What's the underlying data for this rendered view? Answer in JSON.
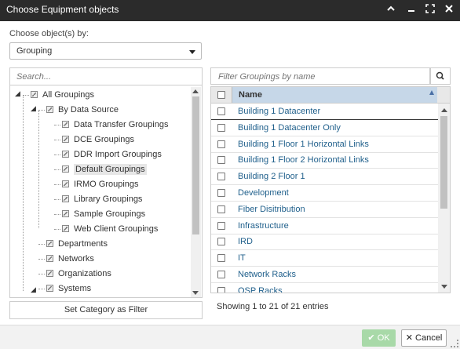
{
  "window": {
    "title": "Choose Equipment objects",
    "controls": [
      "collapse-icon",
      "minimize-icon",
      "maximize-icon",
      "close-icon"
    ]
  },
  "chooser": {
    "label": "Choose object(s) by:",
    "selected": "Grouping"
  },
  "left": {
    "search_placeholder": "Search...",
    "tree": [
      {
        "label": "All Groupings",
        "depth": 0,
        "expanded": true
      },
      {
        "label": "By Data Source",
        "depth": 1,
        "expanded": true
      },
      {
        "label": "Data Transfer Groupings",
        "depth": 2
      },
      {
        "label": "DCE Groupings",
        "depth": 2
      },
      {
        "label": "DDR Import Groupings",
        "depth": 2
      },
      {
        "label": "Default Groupings",
        "depth": 2,
        "selected": true
      },
      {
        "label": "IRMO Groupings",
        "depth": 2
      },
      {
        "label": "Library Groupings",
        "depth": 2
      },
      {
        "label": "Sample Groupings",
        "depth": 2
      },
      {
        "label": "Web Client Groupings",
        "depth": 2
      },
      {
        "label": "Departments",
        "depth": 1
      },
      {
        "label": "Networks",
        "depth": 1
      },
      {
        "label": "Organizations",
        "depth": 1
      },
      {
        "label": "Systems",
        "depth": 1,
        "expanded": true
      }
    ],
    "set_category_label": "Set Category as Filter"
  },
  "right": {
    "filter_placeholder": "Filter Groupings by name",
    "column_name": "Name",
    "rows": [
      "Building 1 Datacenter",
      "Building 1 Datacenter Only",
      "Building 1 Floor 1 Horizontal Links",
      "Building 1 Floor 2 Horizontal Links",
      "Building 2 Floor 1",
      "Development",
      "Fiber Disitribution",
      "Infrastructure",
      "IRD",
      "IT",
      "Network Racks",
      "OSP Racks"
    ],
    "info": "Showing 1 to 21 of 21 entries"
  },
  "footer": {
    "ok_label": "OK",
    "cancel_label": "Cancel"
  },
  "colors": {
    "titlebar": "#2b2b2b",
    "link": "#1f5f8b",
    "header_highlight": "#c6d7e8",
    "ok_button": "#a8d9a8"
  }
}
